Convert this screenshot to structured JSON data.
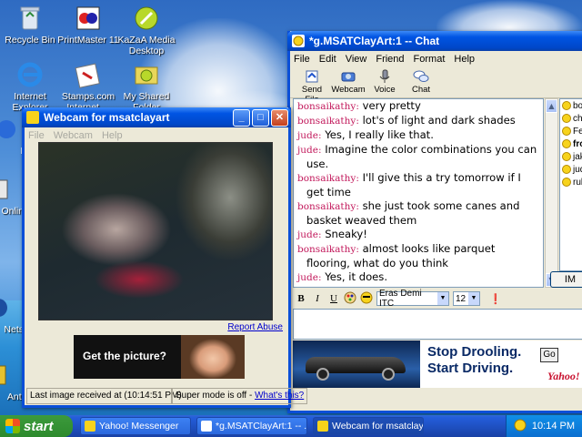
{
  "desktop": {
    "icons": [
      {
        "label": "Recycle Bin",
        "icon": "recycle-bin-icon"
      },
      {
        "label": "PrintMaster 11",
        "icon": "printmaster-icon"
      },
      {
        "label": "KaZaA Media Desktop",
        "icon": "kazaa-icon"
      },
      {
        "label": "Internet Explorer",
        "icon": "internet-explorer-icon"
      },
      {
        "label": "Stamps.com Internet ...",
        "icon": "stamps-icon"
      },
      {
        "label": "My Shared Folder",
        "icon": "shared-folder-icon"
      },
      {
        "label": "Expr",
        "icon": "express-icon"
      },
      {
        "label": "Insta Onlin",
        "icon": "install-icon"
      },
      {
        "label": "Nets",
        "icon": "netscape-icon"
      },
      {
        "label": "Anti",
        "icon": "antivirus-icon"
      }
    ]
  },
  "chat_window": {
    "title": "*g.MSATClayArt:1 -- Chat",
    "menu": [
      "File",
      "Edit",
      "View",
      "Friend",
      "Format",
      "Help"
    ],
    "toolbar": [
      {
        "label": "Send File",
        "icon": "send-file-icon"
      },
      {
        "label": "Webcam",
        "icon": "webcam-icon"
      },
      {
        "label": "Voice",
        "icon": "microphone-icon"
      },
      {
        "label": "Chat",
        "icon": "chat-bubbles-icon"
      }
    ],
    "messages": [
      {
        "nick": "bonsaikathy:",
        "text": "very pretty"
      },
      {
        "nick": "bonsaikathy:",
        "text": "lot's of light and dark shades"
      },
      {
        "nick": "jude:",
        "text": "Yes, I really like that."
      },
      {
        "nick": "jude:",
        "text": "Imagine the color combinations you can use."
      },
      {
        "nick": "bonsaikathy:",
        "text": "I'll give this a try tomorrow if I get time"
      },
      {
        "nick": "bonsaikathy:",
        "text": "she just took some canes and basket weaved them"
      },
      {
        "nick": "jude:",
        "text": "Sneaky!"
      },
      {
        "nick": "bonsaikathy:",
        "text": "almost looks like parquet flooring, what do you think"
      },
      {
        "nick": "jude:",
        "text": "Yes, it does."
      }
    ],
    "users": [
      {
        "name": "bonsa",
        "bold": false
      },
      {
        "name": "chelyh",
        "bold": false
      },
      {
        "name": "Fearle",
        "bold": false
      },
      {
        "name": "frogg",
        "bold": true
      },
      {
        "name": "jakmia",
        "bold": false
      },
      {
        "name": "jude",
        "bold": false
      },
      {
        "name": "rubens",
        "bold": false
      }
    ],
    "im_button": "IM",
    "format": {
      "bold": "B",
      "italic": "I",
      "underline": "U",
      "font": "Eras Demi ITC",
      "size": "12"
    },
    "ad": {
      "line1": "Stop Drooling.",
      "line2": "Start Driving.",
      "go": "Go",
      "brand": "Yahoo!"
    }
  },
  "webcam_window": {
    "title": "Webcam for msatclayart",
    "menu": [
      "File",
      "Webcam",
      "Help"
    ],
    "report_link": "Report Abuse",
    "ad_text": "Get the picture?",
    "status_time": "Last image received at (10:14:51 PM)",
    "status_mode": "Super mode is off -",
    "status_link": "What's this?"
  },
  "taskbar": {
    "start": "start",
    "tasks": [
      {
        "label": "Yahoo! Messenger",
        "icon": "yahoo-messenger-icon"
      },
      {
        "label": "*g.MSATClayArt:1 -- ...",
        "icon": "chat-icon"
      },
      {
        "label": "Webcam for msatclay...",
        "icon": "webcam-icon"
      }
    ],
    "clock": "10:14 PM"
  }
}
